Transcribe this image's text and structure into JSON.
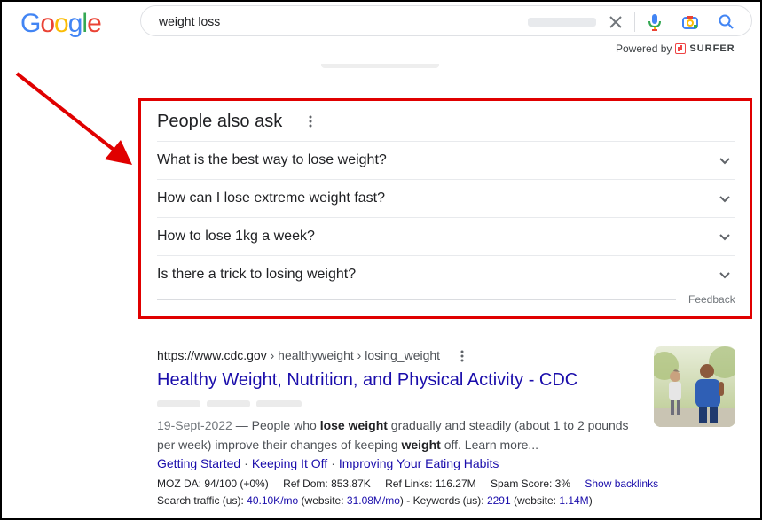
{
  "header": {
    "logo_letters": [
      "G",
      "o",
      "o",
      "g",
      "l",
      "e"
    ],
    "logo_colors": [
      "#4285F4",
      "#EA4335",
      "#FBBC05",
      "#4285F4",
      "#34A853",
      "#EA4335"
    ],
    "search_value": "weight loss",
    "powered_by": "Powered by",
    "surfer": "SURFER"
  },
  "paa": {
    "title": "People also ask",
    "questions": [
      "What is the best way to lose weight?",
      "How can I lose extreme weight fast?",
      "How to lose 1kg a week?",
      "Is there a trick to losing weight?"
    ],
    "feedback": "Feedback",
    "highlight_color": "#e00000"
  },
  "result": {
    "url_domain": "https://www.cdc.gov",
    "url_path": " › healthyweight › losing_weight",
    "title": "Healthy Weight, Nutrition, and Physical Activity - CDC",
    "date": "19-Sept-2022",
    "snippet_pre": " — People who ",
    "snippet_b1": "lose weight",
    "snippet_mid": " gradually and steadily (about 1 to 2 pounds per week) improve their changes of keeping ",
    "snippet_b2": "weight",
    "snippet_post": " off. Learn more...",
    "sitelinks": [
      "Getting Started",
      "Keeping It Off",
      "Improving Your Eating Habits"
    ],
    "sitelink_sep": "·",
    "metrics": {
      "moz": "MOZ DA: 94/100 (+0%)",
      "ref_dom": "Ref Dom: 853.87K",
      "ref_links": "Ref Links: 116.27M",
      "spam": "Spam Score: 3%",
      "backlinks": "Show backlinks",
      "traffic_label": "Search traffic (us): ",
      "traffic": "40.10K/mo",
      "website_label1": " (website: ",
      "website_traffic": "31.08M/mo",
      "keywords_label": ") - Keywords (us): ",
      "keywords": "2291",
      "website_label2": " (website: ",
      "website_keywords": "1.14M",
      "close_paren": ")"
    }
  }
}
